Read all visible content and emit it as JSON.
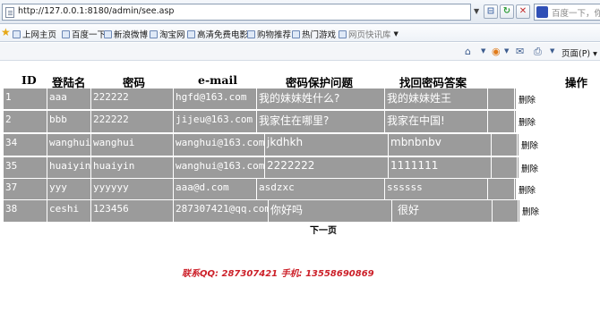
{
  "browser": {
    "url": "http://127.0.0.1:8180/admin/see.asp",
    "search_placeholder": "百度一下，你就",
    "favorites": [
      "上网主页",
      "百度一下",
      "新浪微博",
      "淘宝网",
      "高清免费电影",
      "购物推荐",
      "热门游戏",
      "网页快讯库"
    ],
    "page_menu_label": "页面(P)"
  },
  "table": {
    "headers": [
      "ID",
      "登陆名",
      "密码",
      "e-mail",
      "密码保护问题",
      "找回密码答案",
      "操作"
    ],
    "delete_label": "删除",
    "rows": [
      {
        "id": "1",
        "login": "aaa",
        "password": "222222",
        "email": "hgfd@163.com",
        "question": "我的妹妹姓什么?",
        "answer": "我的妹妹姓王"
      },
      {
        "id": "2",
        "login": "bbb",
        "password": "222222",
        "email": "jijeu@163.com",
        "question": "我家住在哪里?",
        "answer": "我家在中国!"
      },
      {
        "id": "34",
        "login": "wanghui",
        "password": "wanghui",
        "email": "wanghui@163.com",
        "question": "jkdhkh",
        "answer": "mbnbnbv"
      },
      {
        "id": "35",
        "login": "huaiyin",
        "password": "huaiyin",
        "email": "wanghui@163.com",
        "question": "2222222",
        "answer": "1111111"
      },
      {
        "id": "37",
        "login": "yyy",
        "password": "yyyyyy",
        "email": "aaa@d.com",
        "question": "asdzxc",
        "answer": "ssssss"
      },
      {
        "id": "38",
        "login": "ceshi",
        "password": "123456",
        "email": "287307421@qq.com",
        "question": "你好吗",
        "answer": "很好"
      }
    ]
  },
  "pagination": {
    "next_label": "下一页"
  },
  "footer": {
    "contact": "联系QQ: 287307421  手机: 13558690869"
  },
  "colors": {
    "row_bg": "#9b9b9b",
    "contact": "#cc1f28"
  }
}
